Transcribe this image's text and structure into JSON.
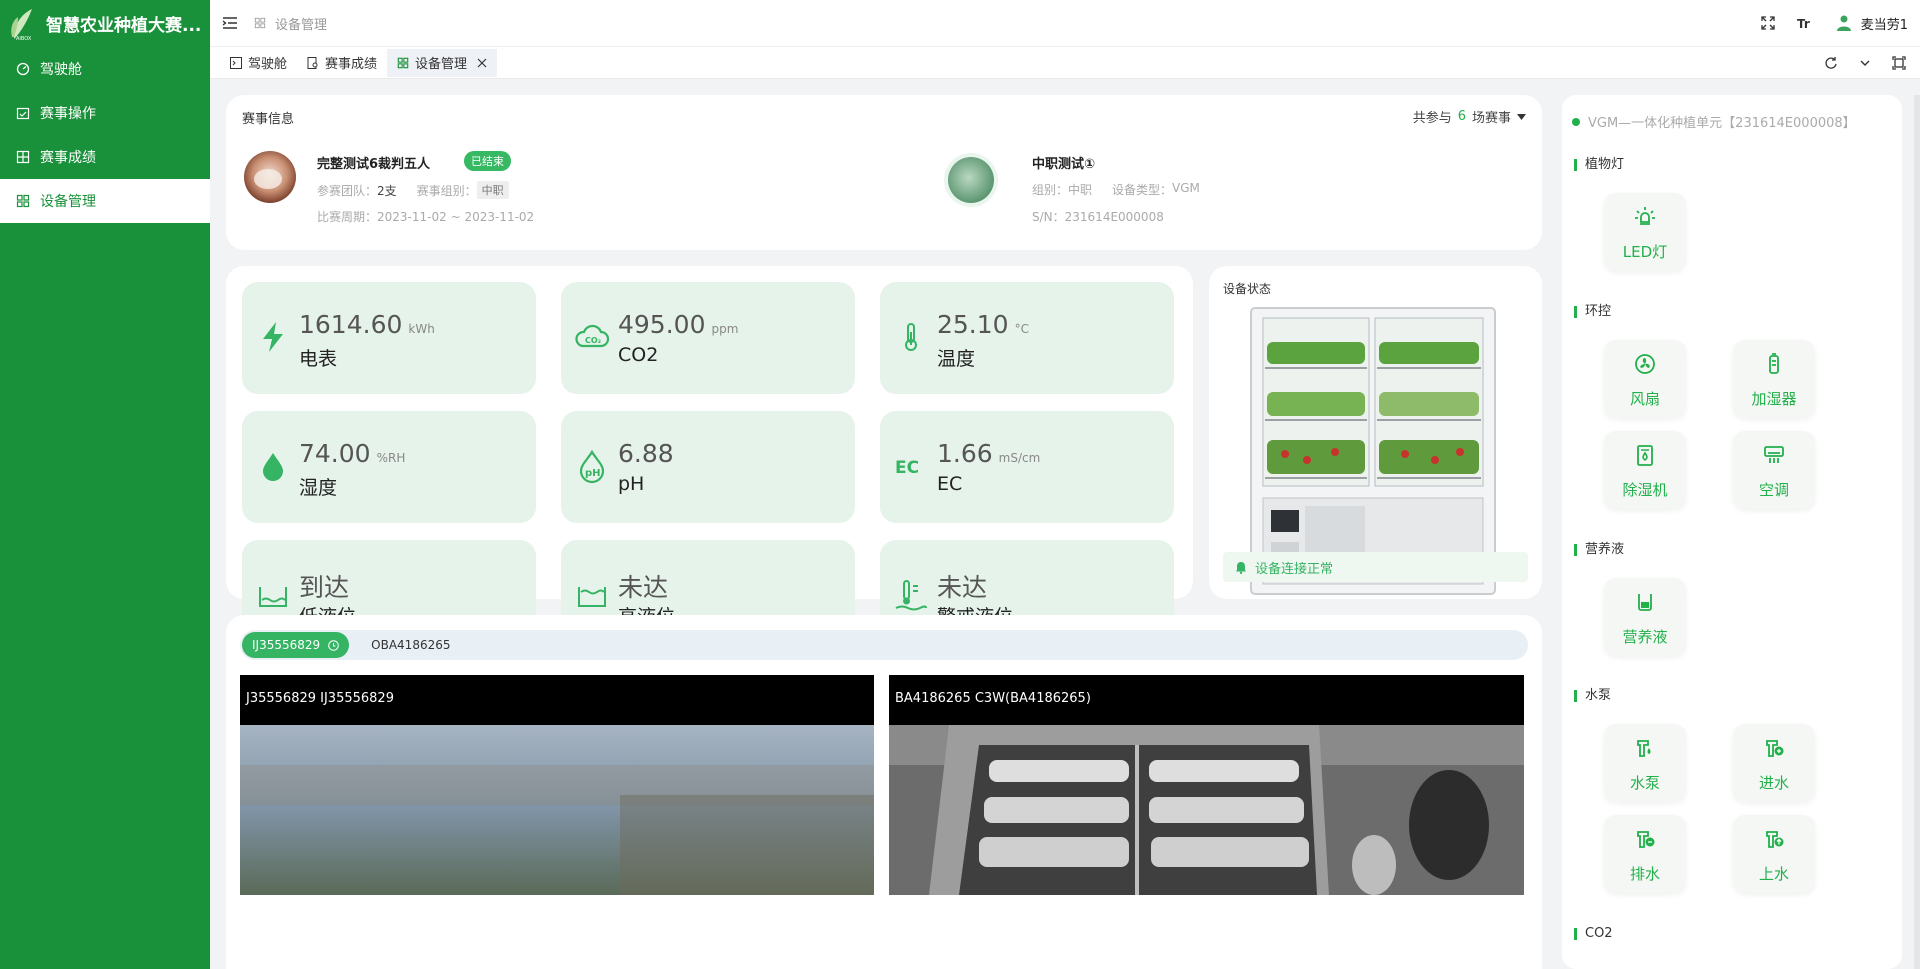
{
  "app": {
    "title": "智慧农业种植大赛..."
  },
  "sidebar": {
    "items": [
      {
        "label": "驾驶舱"
      },
      {
        "label": "赛事操作"
      },
      {
        "label": "赛事成绩"
      },
      {
        "label": "设备管理"
      }
    ]
  },
  "topbar": {
    "breadcrumb": "设备管理",
    "user": "麦当劳1"
  },
  "tabs": [
    {
      "label": "驾驶舱"
    },
    {
      "label": "赛事成绩"
    },
    {
      "label": "设备管理"
    }
  ],
  "event": {
    "section_title": "赛事信息",
    "count_prefix": "共参与",
    "count": "6",
    "count_suffix": "场赛事",
    "name": "完整测试6裁判五人",
    "status": "已结束",
    "teams_label": "参赛团队：",
    "teams_value": "2支",
    "group_label": "赛事组别：",
    "group_value": "中职",
    "period_label": "比赛周期：",
    "period_value": "2023-11-02 ~ 2023-11-02"
  },
  "device_info": {
    "name": "中职测试①",
    "group_label": "组别：",
    "group_value": "中职",
    "type_label": "设备类型：",
    "type_value": "VGM",
    "sn_label": "S/N：",
    "sn_value": "231614E000008"
  },
  "metrics": [
    {
      "value": "1614.60",
      "unit": "kWh",
      "label": "电表",
      "icon": "lightning-icon"
    },
    {
      "value": "495.00",
      "unit": "ppm",
      "label": "CO2",
      "icon": "co2-cloud-icon"
    },
    {
      "value": "25.10",
      "unit": "°C",
      "label": "温度",
      "icon": "thermometer-icon"
    },
    {
      "value": "74.00",
      "unit": "%RH",
      "label": "湿度",
      "icon": "droplet-icon"
    },
    {
      "value": "6.88",
      "unit": "",
      "label": "pH",
      "icon": "ph-icon"
    },
    {
      "value": "1.66",
      "unit": "mS/cm",
      "label": "EC",
      "icon": "ec-icon"
    },
    {
      "value": "到达",
      "unit": "",
      "label": "低液位",
      "icon": "low-level-icon"
    },
    {
      "value": "未达",
      "unit": "",
      "label": "高液位",
      "icon": "high-level-icon"
    },
    {
      "value": "未达",
      "unit": "",
      "label": "警戒液位",
      "icon": "warning-level-icon"
    }
  ],
  "device_status": {
    "title": "设备状态",
    "connection": "设备连接正常"
  },
  "cameras": {
    "tabs": [
      {
        "label": "IJ35556829"
      },
      {
        "label": "OBA4186265"
      }
    ],
    "feeds": [
      {
        "title": "J35556829 IJ35556829"
      },
      {
        "title": "BA4186265 C3W(BA4186265)"
      }
    ]
  },
  "control_panel": {
    "title": "VGM—一体化种植单元【231614E000008】",
    "sections": [
      {
        "title": "植物灯",
        "items": [
          {
            "label": "LED灯"
          }
        ]
      },
      {
        "title": "环控",
        "items": [
          {
            "label": "风扇"
          },
          {
            "label": "加湿器"
          },
          {
            "label": "除湿机"
          },
          {
            "label": "空调"
          }
        ]
      },
      {
        "title": "营养液",
        "items": [
          {
            "label": "营养液"
          }
        ]
      },
      {
        "title": "水泵",
        "items": [
          {
            "label": "水泵"
          },
          {
            "label": "进水"
          },
          {
            "label": "排水"
          },
          {
            "label": "上水"
          }
        ]
      },
      {
        "title": "CO2",
        "items": []
      }
    ]
  },
  "colors": {
    "primary": "#19913a",
    "accent": "#22b04b",
    "metric_bg": "#e6f3ea"
  }
}
